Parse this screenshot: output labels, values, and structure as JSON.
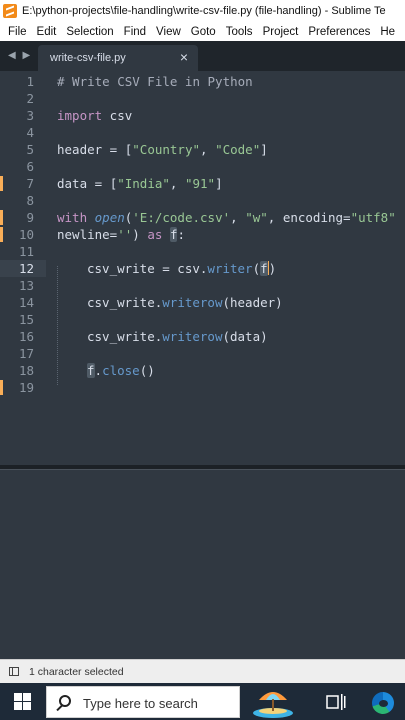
{
  "window": {
    "title": "E:\\python-projects\\file-handling\\write-csv-file.py (file-handling) - Sublime Te"
  },
  "menu": [
    "File",
    "Edit",
    "Selection",
    "Find",
    "View",
    "Goto",
    "Tools",
    "Project",
    "Preferences",
    "He"
  ],
  "tab": {
    "nav": "◀ ▶",
    "label": "write-csv-file.py",
    "close": "×"
  },
  "gutter": [
    "1",
    "2",
    "3",
    "4",
    "5",
    "6",
    "7",
    "8",
    "9",
    "10",
    "11",
    "12",
    "13",
    "14",
    "15",
    "16",
    "17",
    "18",
    "19"
  ],
  "code": {
    "l1": "# Write CSV File in Python",
    "l3_kw": "import",
    "l3_rest": " csv",
    "l5_a": "header = ",
    "l5_b": "[",
    "l5_c": "\"Country\"",
    "l5_d": ", ",
    "l5_e": "\"Code\"",
    "l5_f": "]",
    "l7_a": "data = ",
    "l7_b": "[",
    "l7_c": "\"India\"",
    "l7_d": ", ",
    "l7_e": "\"91\"",
    "l7_f": "]",
    "l9_kw": "with ",
    "l9_fn": "open",
    "l9_p1": "(",
    "l9_s1": "'E:/code.csv'",
    "l9_c1": ", ",
    "l9_s2": "\"w\"",
    "l9_c2": ", encoding=",
    "l9_s3": "\"utf8\"",
    "l10_a": "newline=",
    "l10_s": "''",
    "l10_b": ") ",
    "l10_kw": "as",
    "l10_c": " ",
    "l10_f": "f",
    "l10_d": ":",
    "l12_a": "csv_write = csv.",
    "l12_fn": "writer",
    "l12_p1": "(",
    "l12_f": "f",
    "l12_p2": ")",
    "l14_a": "csv_write.",
    "l14_fn": "writerow",
    "l14_b": "(header)",
    "l16_a": "csv_write.",
    "l16_fn": "writerow",
    "l16_b": "(data)",
    "l18_f": "f",
    "l18_a": ".",
    "l18_fn": "close",
    "l18_b": "()"
  },
  "status": {
    "text": "1 character selected"
  },
  "taskbar": {
    "search_placeholder": "Type here to search"
  }
}
